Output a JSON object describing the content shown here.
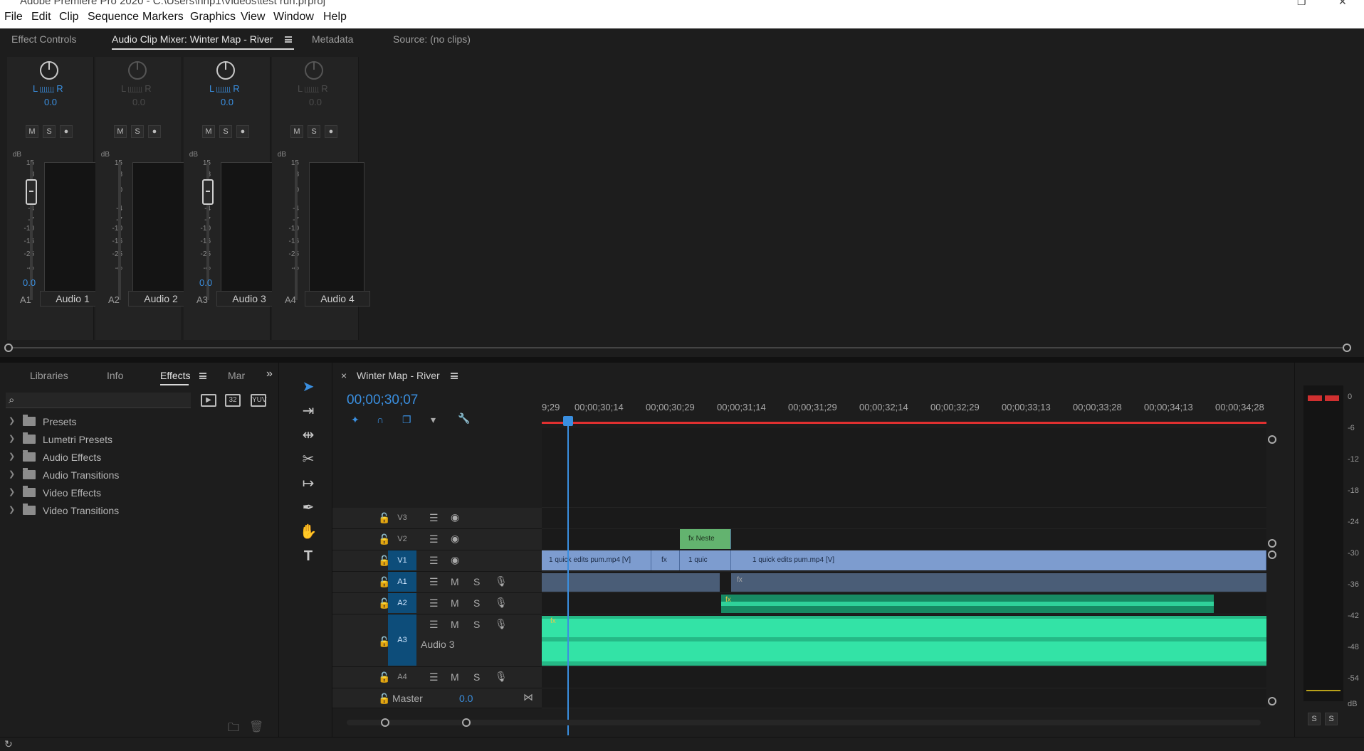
{
  "window": {
    "title": "Adobe Premiere Pro 2020 - C:\\Users\\hnp1\\Videos\\test run.prproj"
  },
  "menu": [
    "File",
    "Edit",
    "Clip",
    "Sequence",
    "Markers",
    "Graphics",
    "View",
    "Window",
    "Help"
  ],
  "upper_tabs": [
    "Effect Controls",
    "Audio Clip Mixer: Winter Map - River",
    "Metadata",
    "Source: (no clips)"
  ],
  "mixer": {
    "channels": [
      {
        "id": "A1",
        "name": "Audio 1",
        "pan": "0.0",
        "fader_value": "0.0",
        "active": true
      },
      {
        "id": "A2",
        "name": "Audio 2",
        "pan": "0.0",
        "fader_value": "",
        "active": false
      },
      {
        "id": "A3",
        "name": "Audio 3",
        "pan": "0.0",
        "fader_value": "0.0",
        "active": true
      },
      {
        "id": "A4",
        "name": "Audio 4",
        "pan": "0.0",
        "fader_value": "",
        "active": false
      }
    ],
    "scale": [
      "dB",
      "15",
      "8",
      "0",
      "-4",
      "-7",
      "-10",
      "-16",
      "-25",
      "-∞"
    ],
    "m": "M",
    "s": "S",
    "l": "L",
    "r": "R"
  },
  "effects_panel": {
    "tabs": [
      "Libraries",
      "Info",
      "Effects",
      "Mar"
    ],
    "more": "»",
    "buttons": [
      "32",
      "YUV"
    ],
    "items": [
      "Presets",
      "Lumetri Presets",
      "Audio Effects",
      "Audio Transitions",
      "Video Effects",
      "Video Transitions"
    ]
  },
  "timeline": {
    "sequence_name": "Winter Map - River",
    "timecode": "00;00;30;07",
    "ruler_ticks": [
      "9;29",
      "00;00;30;14",
      "00;00;30;29",
      "00;00;31;14",
      "00;00;31;29",
      "00;00;32;14",
      "00;00;32;29",
      "00;00;33;13",
      "00;00;33;28",
      "00;00;34;13",
      "00;00;34;28"
    ],
    "tracks": [
      "V3",
      "V2",
      "V1",
      "A1",
      "A2",
      "A3",
      "A4"
    ],
    "track_name_a3": "Audio 3",
    "master_label": "Master",
    "master_value": "0.0",
    "clips": {
      "v1a": "1 quick edits pum.mp4 [V]",
      "v1b": "fx",
      "v1c": "1 quic",
      "v1d": "1 quick edits pum.mp4 [V]",
      "v2": "Neste",
      "fx": "fx"
    }
  },
  "master_meter": {
    "scale": [
      "0",
      "-6",
      "-12",
      "-18",
      "-24",
      "-30",
      "-36",
      "-42",
      "-48",
      "-54",
      "dB"
    ],
    "solo_labels": [
      "S",
      "S"
    ]
  },
  "colors": {
    "accent": "#3a8fe0",
    "video_clip": "#7d9ccf",
    "audio_wave": "#2fd29a",
    "playhead": "#3a8fe0"
  }
}
